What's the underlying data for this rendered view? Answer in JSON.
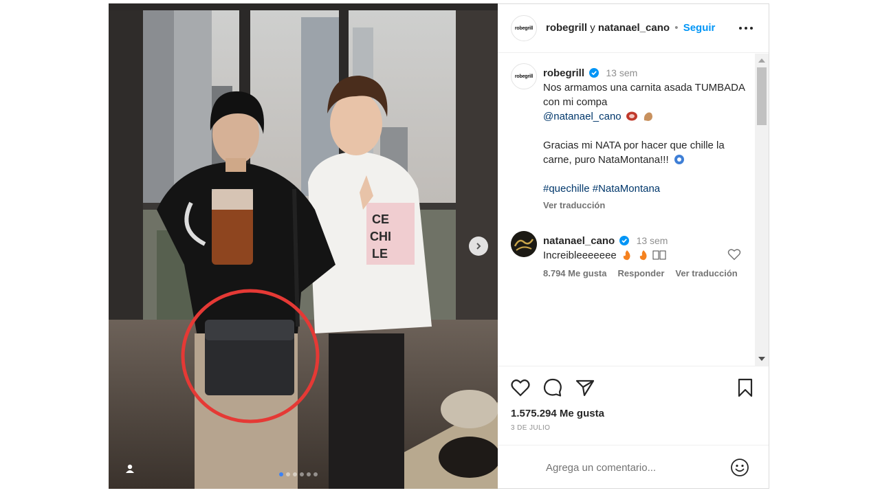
{
  "post": {
    "author": "robegrill",
    "connector": "y",
    "coauthor": "natanael_cano",
    "separator": "•",
    "follow_label": "Seguir",
    "avatar_text": "robegrill"
  },
  "caption": {
    "username": "robegrill",
    "time": "13 sem",
    "line1": "Nos armamos una carnita asada TUMBADA con mi compa",
    "mention": "@natanael_cano",
    "line2": "Gracias mi NATA por hacer que chille la carne, puro NataMontana!!!",
    "hashtag1": "#quechille",
    "hashtag2": "#NataMontana",
    "see_translation": "Ver traducción"
  },
  "reply": {
    "username": "natanael_cano",
    "time": "13 sem",
    "text": "Increibleeeeeee",
    "likes": "8.794 Me gusta",
    "reply_label": "Responder",
    "see_translation": "Ver traducción"
  },
  "footer": {
    "likes": "1.575.294 Me gusta",
    "date": "3 DE JULIO",
    "comment_placeholder": "Agrega un comentario..."
  },
  "carousel": {
    "total": 6,
    "active": 1
  },
  "colors": {
    "follow": "#0095f6",
    "verified": "#0095f6",
    "highlight_circle": "#e53935"
  },
  "icons": [
    "heart-icon",
    "comment-icon",
    "share-icon",
    "bookmark-icon",
    "smile-icon",
    "more-icon",
    "user-tag-icon",
    "chevron-right-icon",
    "verified-badge-icon"
  ]
}
